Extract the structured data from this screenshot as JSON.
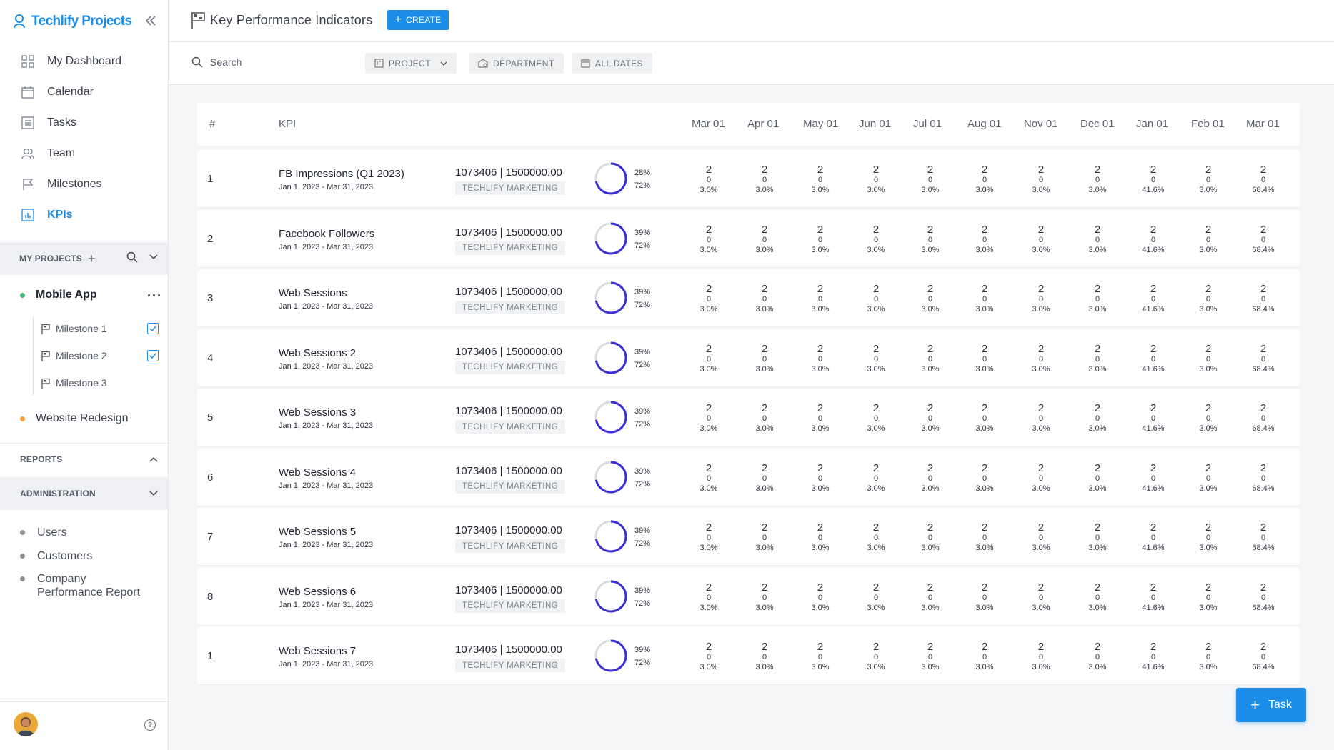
{
  "app": {
    "brand": "Techlify Projects"
  },
  "sidebar": {
    "nav": [
      {
        "label": "My Dashboard",
        "icon": "dashboard-icon"
      },
      {
        "label": "Calendar",
        "icon": "calendar-icon"
      },
      {
        "label": "Tasks",
        "icon": "tasks-icon"
      },
      {
        "label": "Team",
        "icon": "team-icon"
      },
      {
        "label": "Milestones",
        "icon": "flag-icon"
      },
      {
        "label": "KPIs",
        "icon": "chart-icon",
        "active": true
      }
    ],
    "my_projects_label": "MY PROJECTS",
    "projects": [
      {
        "name": "Mobile App",
        "color": "#3cb371"
      },
      {
        "name": "Website Redesign",
        "color": "#f0a43a"
      }
    ],
    "milestones": [
      {
        "label": "Milestone 1",
        "checked": true
      },
      {
        "label": "Milestone 2",
        "checked": true
      },
      {
        "label": "Milestone 3",
        "checked": false
      }
    ],
    "reports_label": "REPORTS",
    "administration_label": "ADMINISTRATION",
    "admin_items": [
      "Users",
      "Customers",
      "Company Performance Report"
    ]
  },
  "header": {
    "title": "Key Performance Indicators",
    "create_label": "CREATE"
  },
  "filters": {
    "search_placeholder": "Search",
    "project_label": "PROJECT",
    "department_label": "DEPARTMENT",
    "dates_label": "ALL DATES"
  },
  "table": {
    "col_num": "#",
    "col_kpi": "KPI",
    "months": [
      "Mar 01",
      "Apr 01",
      "May 01",
      "Jun 01",
      "Jul 01",
      "Aug 01",
      "Nov 01",
      "Dec 01",
      "Jan 01",
      "Feb 01",
      "Mar 01"
    ],
    "month_values": {
      "a": "2",
      "b": "0",
      "c": [
        "3.0%",
        "3.0%",
        "3.0%",
        "3.0%",
        "3.0%",
        "3.0%",
        "3.0%",
        "3.0%",
        "41.6%",
        "3.0%",
        "68.4%"
      ]
    },
    "rows": [
      {
        "num": "1",
        "name": "FB Impressions (Q1 2023)",
        "dates": "Jan 1, 2023 - Mar 31, 2023",
        "value": "1073406 | 1500000.00",
        "dept": "TECHLIFY MARKETING",
        "pct1": "28%",
        "pct2": "72%",
        "progress": 0.72
      },
      {
        "num": "2",
        "name": "Facebook Followers",
        "dates": "Jan 1, 2023 - Mar 31, 2023",
        "value": "1073406 | 1500000.00",
        "dept": "TECHLIFY MARKETING",
        "pct1": "39%",
        "pct2": "72%",
        "progress": 0.72
      },
      {
        "num": "3",
        "name": "Web Sessions",
        "dates": "Jan 1, 2023 - Mar 31, 2023",
        "value": "1073406 | 1500000.00",
        "dept": "TECHLIFY MARKETING",
        "pct1": "39%",
        "pct2": "72%",
        "progress": 0.72
      },
      {
        "num": "4",
        "name": "Web Sessions 2",
        "dates": "Jan 1, 2023 - Mar 31, 2023",
        "value": "1073406 | 1500000.00",
        "dept": "TECHLIFY MARKETING",
        "pct1": "39%",
        "pct2": "72%",
        "progress": 0.72
      },
      {
        "num": "5",
        "name": "Web Sessions 3",
        "dates": "Jan 1, 2023 - Mar 31, 2023",
        "value": "1073406 | 1500000.00",
        "dept": "TECHLIFY MARKETING",
        "pct1": "39%",
        "pct2": "72%",
        "progress": 0.72
      },
      {
        "num": "6",
        "name": "Web Sessions 4",
        "dates": "Jan 1, 2023 - Mar 31, 2023",
        "value": "1073406 | 1500000.00",
        "dept": "TECHLIFY MARKETING",
        "pct1": "39%",
        "pct2": "72%",
        "progress": 0.72
      },
      {
        "num": "7",
        "name": "Web Sessions 5",
        "dates": "Jan 1, 2023 - Mar 31, 2023",
        "value": "1073406 | 1500000.00",
        "dept": "TECHLIFY MARKETING",
        "pct1": "39%",
        "pct2": "72%",
        "progress": 0.72
      },
      {
        "num": "8",
        "name": "Web Sessions 6",
        "dates": "Jan 1, 2023 - Mar 31, 2023",
        "value": "1073406 | 1500000.00",
        "dept": "TECHLIFY MARKETING",
        "pct1": "39%",
        "pct2": "72%",
        "progress": 0.72
      },
      {
        "num": "1",
        "name": "Web Sessions 7",
        "dates": "Jan 1, 2023 - Mar 31, 2023",
        "value": "1073406 | 1500000.00",
        "dept": "TECHLIFY MARKETING",
        "pct1": "39%",
        "pct2": "72%",
        "progress": 0.72
      }
    ]
  },
  "fab": {
    "label": "Task"
  },
  "colors": {
    "accent": "#1b8ce8",
    "ring": "#3d2fd6",
    "ring_track": "#d9dbe1"
  }
}
